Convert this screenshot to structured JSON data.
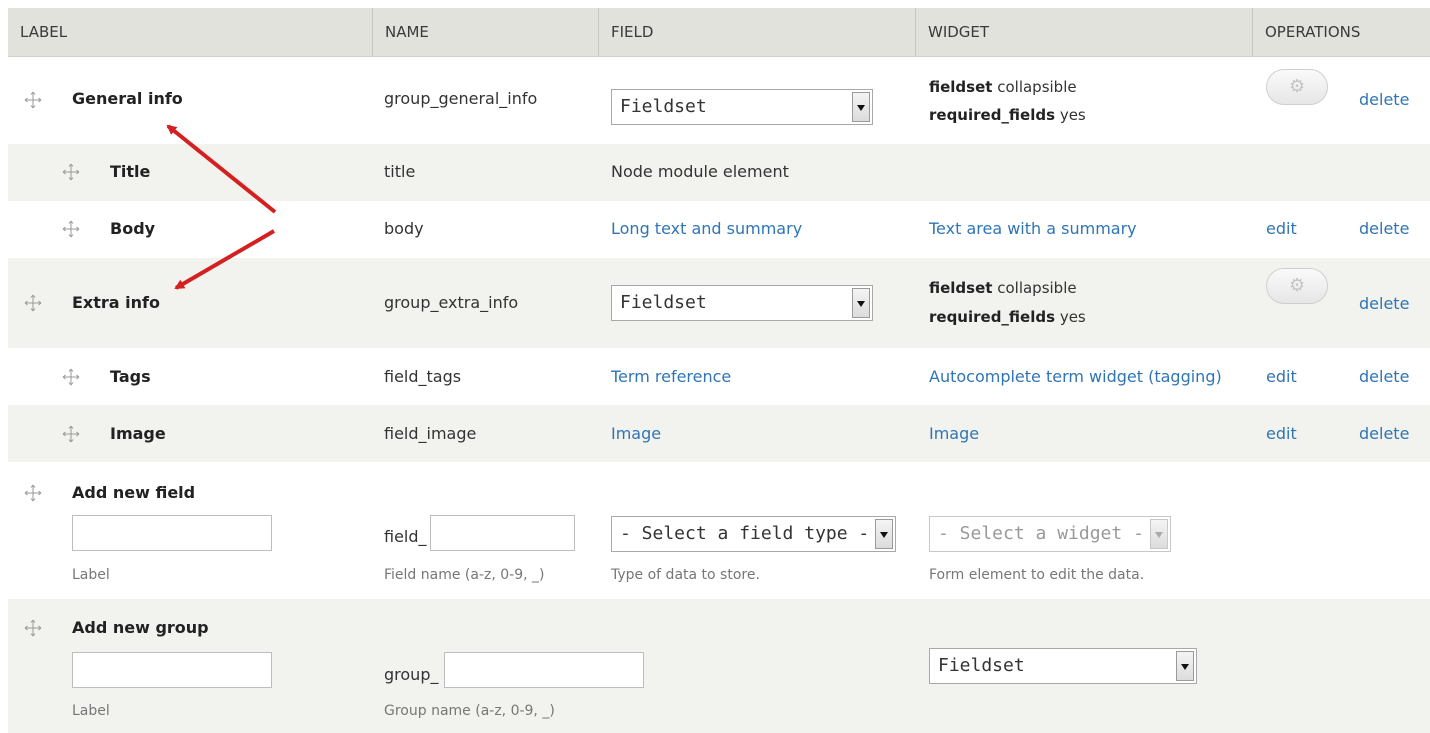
{
  "headers": {
    "label": "LABEL",
    "name": "NAME",
    "field": "FIELD",
    "widget": "WIDGET",
    "operations": "OPERATIONS"
  },
  "rows": [
    {
      "label": "General info",
      "name": "group_general_info",
      "field_select": "Fieldset",
      "widget_lines": [
        {
          "key": "fieldset",
          "value": " collapsible"
        },
        {
          "key": "required_fields",
          "value": " yes"
        }
      ],
      "delete": "delete"
    },
    {
      "label": "Title",
      "name": "title",
      "field": "Node module element"
    },
    {
      "label": "Body",
      "name": "body",
      "field": "Long text and summary",
      "widget": "Text area with a summary",
      "edit": "edit",
      "delete": "delete"
    },
    {
      "label": "Extra info",
      "name": "group_extra_info",
      "field_select": "Fieldset",
      "widget_lines": [
        {
          "key": "fieldset",
          "value": " collapsible"
        },
        {
          "key": "required_fields",
          "value": " yes"
        }
      ],
      "delete": "delete"
    },
    {
      "label": "Tags",
      "name": "field_tags",
      "field": "Term reference",
      "widget": "Autocomplete term widget (tagging)",
      "edit": "edit",
      "delete": "delete"
    },
    {
      "label": "Image",
      "name": "field_image",
      "field": "Image",
      "widget": "Image",
      "edit": "edit",
      "delete": "delete"
    }
  ],
  "add_field": {
    "title": "Add new field",
    "label_value": "",
    "label_desc": "Label",
    "name_prefix": "field_",
    "name_value": "",
    "name_desc": "Field name (a-z, 0-9, _)",
    "type_select": "- Select a field type -",
    "type_desc": "Type of data to store.",
    "widget_select": "- Select a widget -",
    "widget_desc": "Form element to edit the data."
  },
  "add_group": {
    "title": "Add new group",
    "label_value": "",
    "label_desc": "Label",
    "name_prefix": "group_",
    "name_value": "",
    "name_desc": "Group name (a-z, 0-9, _)",
    "widget_select": "Fieldset"
  },
  "colors": {
    "link": "#2f75b5",
    "header_bg": "#e1e2dc",
    "stripe_bg": "#f2f2ee",
    "annotation_arrow": "#d42020"
  },
  "icons": {
    "drag": "drag-handle-icon",
    "settings": "gear-icon"
  }
}
